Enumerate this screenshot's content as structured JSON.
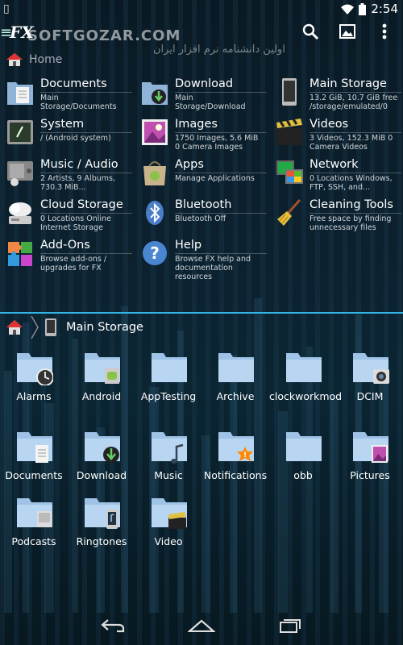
{
  "status": {
    "time": "2:54"
  },
  "actionbar": {
    "logo": "FX",
    "watermark": "SOFTGOZAR.COM",
    "watermark_sub": "اولین دانشنامه نرم افزار ایران"
  },
  "top_crumb": {
    "label": "Home"
  },
  "bookmarks": [
    {
      "title": "Documents",
      "sub": "Main Storage/Documents",
      "icon": "documents-icon"
    },
    {
      "title": "Download",
      "sub": "Main Storage/Download",
      "icon": "download-icon"
    },
    {
      "title": "Main Storage",
      "sub": "13.2 GiB, 10.7 GiB free /storage/emulated/0",
      "icon": "device-icon"
    },
    {
      "title": "System",
      "sub": "/ (Android system)",
      "icon": "terminal-icon"
    },
    {
      "title": "Images",
      "sub": "1750 Images, 5.6 MiB 0 Camera Images",
      "icon": "image-icon"
    },
    {
      "title": "Videos",
      "sub": "3 Videos, 152.3 MiB 0 Camera Videos",
      "icon": "clapper-icon"
    },
    {
      "title": "Music / Audio",
      "sub": "2 Artists, 9 Albums, 730.3 MiB...",
      "icon": "music-icon"
    },
    {
      "title": "Apps",
      "sub": "Manage Applications",
      "icon": "apps-icon"
    },
    {
      "title": "Network",
      "sub": "0 Locations Windows, FTP, SSH, and...",
      "icon": "network-icon"
    },
    {
      "title": "Cloud Storage",
      "sub": "0 Locations Online Internet Storage",
      "icon": "cloud-icon"
    },
    {
      "title": "Bluetooth",
      "sub": "Bluetooth Off",
      "icon": "bluetooth-icon"
    },
    {
      "title": "Cleaning Tools",
      "sub": "Free space by finding unnecessary files",
      "icon": "broom-icon"
    },
    {
      "title": "Add-Ons",
      "sub": "Browse add-ons / upgrades for FX",
      "icon": "puzzle-icon"
    },
    {
      "title": "Help",
      "sub": "Browse FX help and documentation resources",
      "icon": "help-icon"
    }
  ],
  "pane2": {
    "label": "Main Storage"
  },
  "folders": [
    {
      "label": "Alarms",
      "badge": "clock"
    },
    {
      "label": "Android",
      "badge": "android"
    },
    {
      "label": "AppTesting",
      "badge": ""
    },
    {
      "label": "Archive",
      "badge": ""
    },
    {
      "label": "clockworkmod",
      "badge": ""
    },
    {
      "label": "DCIM",
      "badge": "camera"
    },
    {
      "label": "Documents",
      "badge": "doc"
    },
    {
      "label": "Download",
      "badge": "download"
    },
    {
      "label": "Music",
      "badge": "music"
    },
    {
      "label": "Notifications",
      "badge": "notify"
    },
    {
      "label": "obb",
      "badge": ""
    },
    {
      "label": "Pictures",
      "badge": "picture"
    },
    {
      "label": "Podcasts",
      "badge": "podcast"
    },
    {
      "label": "Ringtones",
      "badge": "ringtone"
    },
    {
      "label": "Video",
      "badge": "clapper"
    }
  ],
  "colors": {
    "accent": "#33b5e5",
    "folder": "#9ec3e6"
  }
}
